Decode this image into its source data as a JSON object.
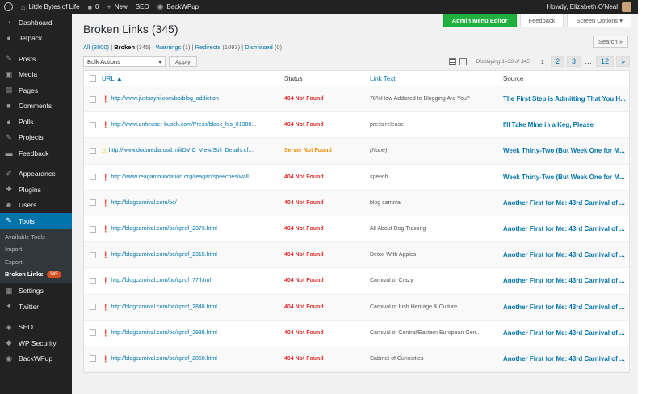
{
  "adminbar": {
    "site_name": "Little Bytes of Life",
    "comments_count": "0",
    "new_label": "New",
    "seo_label": "SEO",
    "backwpup_label": "BackWPup",
    "howdy": "Howdy, Elizabeth O'Neal"
  },
  "sidebar": {
    "items": [
      {
        "label": "Dashboard",
        "icon": "dashboard-icon"
      },
      {
        "label": "Jetpack",
        "icon": "jetpack-icon"
      },
      {
        "label": "Posts",
        "icon": "pin-icon"
      },
      {
        "label": "Media",
        "icon": "media-icon"
      },
      {
        "label": "Pages",
        "icon": "pages-icon"
      },
      {
        "label": "Comments",
        "icon": "comments-icon"
      },
      {
        "label": "Polls",
        "icon": "polls-icon"
      },
      {
        "label": "Projects",
        "icon": "projects-icon"
      },
      {
        "label": "Feedback",
        "icon": "feedback-icon"
      },
      {
        "label": "Appearance",
        "icon": "appearance-icon"
      },
      {
        "label": "Plugins",
        "icon": "plugins-icon"
      },
      {
        "label": "Users",
        "icon": "users-icon"
      },
      {
        "label": "Tools",
        "icon": "tools-icon"
      },
      {
        "label": "Settings",
        "icon": "settings-icon"
      },
      {
        "label": "Twitter",
        "icon": "twitter-icon"
      },
      {
        "label": "SEO",
        "icon": "seo-icon"
      },
      {
        "label": "WP Security",
        "icon": "security-icon"
      },
      {
        "label": "BackWPup",
        "icon": "backwpup-icon"
      }
    ],
    "tools_sub": [
      "Available Tools",
      "Import",
      "Export",
      "Broken Links"
    ],
    "broken_count": "345"
  },
  "header": {
    "admin_menu_editor": "Admin Menu Editor",
    "feedback": "Feedback",
    "screen_options": "Screen Options",
    "title": "Broken Links (345)",
    "search_btn": "Search »"
  },
  "filters": {
    "all": "All",
    "all_count": "(3800)",
    "broken": "Broken",
    "broken_count": "(345)",
    "warnings": "Warnings",
    "warnings_count": "(1)",
    "redirects": "Redirects",
    "redirects_count": "(1093)",
    "dismissed": "Dismissed",
    "dismissed_count": "(0)"
  },
  "tablenav": {
    "bulk_actions": "Bulk Actions",
    "apply": "Apply",
    "displaying": "Displaying 1–30 of 345",
    "pages": [
      "1",
      "2",
      "3",
      "…",
      "12",
      "»"
    ]
  },
  "table": {
    "headers": {
      "url": "URL ▲",
      "status": "Status",
      "link_text": "Link Text",
      "source": "Source"
    },
    "rows": [
      {
        "type": "err",
        "url": "http://www.justsayhi.com/bb/blog_addiction",
        "status": "404 Not Found",
        "link_text": "78%How Addicted to Blogging Are You?",
        "source": "The First Step is Admitting That You H..."
      },
      {
        "type": "err",
        "url": "http://www.anheuser-busch.com/Press/black_his_01300...",
        "status": "404 Not Found",
        "link_text": "press release",
        "source": "I'll Take Mine in a Keg, Please"
      },
      {
        "type": "warn",
        "url": "http://www.dodmedia.osd.mil/DVIC_View/Still_Details.cf...",
        "status": "Server Not Found",
        "link_text": "(None)",
        "source": "Week Thirty-Two (But Week One for M..."
      },
      {
        "type": "err",
        "url": "http://www.reaganfoundation.org/reagan/speeches/wall....",
        "status": "404 Not Found",
        "link_text": "speech",
        "source": "Week Thirty-Two (But Week One for M..."
      },
      {
        "type": "err",
        "url": "http://blogcarnival.com/bc/",
        "status": "404 Not Found",
        "link_text": "blog carnival",
        "source": "Another First for Me: 43rd Carnival of ..."
      },
      {
        "type": "err",
        "url": "http://blogcarnival.com/bc/cprof_2373.html",
        "status": "404 Not Found",
        "link_text": "All About Dog Training",
        "source": "Another First for Me: 43rd Carnival of ..."
      },
      {
        "type": "err",
        "url": "http://blogcarnival.com/bc/cprof_2315.html",
        "status": "404 Not Found",
        "link_text": "Detox With Apples",
        "source": "Another First for Me: 43rd Carnival of ..."
      },
      {
        "type": "err",
        "url": "http://blogcarnival.com/bc/cprof_77.html",
        "status": "404 Not Found",
        "link_text": "Carnival of Crazy",
        "source": "Another First for Me: 43rd Carnival of ..."
      },
      {
        "type": "err",
        "url": "http://blogcarnival.com/bc/cprof_2848.html",
        "status": "404 Not Found",
        "link_text": "Carnival of Irish Heritage & Culture",
        "source": "Another First for Me: 43rd Carnival of ..."
      },
      {
        "type": "err",
        "url": "http://blogcarnival.com/bc/cprof_2939.html",
        "status": "404 Not Found",
        "link_text": "Carnival of Central/Eastern European Gen...",
        "source": "Another First for Me: 43rd Carnival of ..."
      },
      {
        "type": "err",
        "url": "http://blogcarnival.com/bc/cprof_2850.html",
        "status": "404 Not Found",
        "link_text": "Cabinet of Curiosities",
        "source": "Another First for Me: 43rd Carnival of ..."
      }
    ]
  }
}
